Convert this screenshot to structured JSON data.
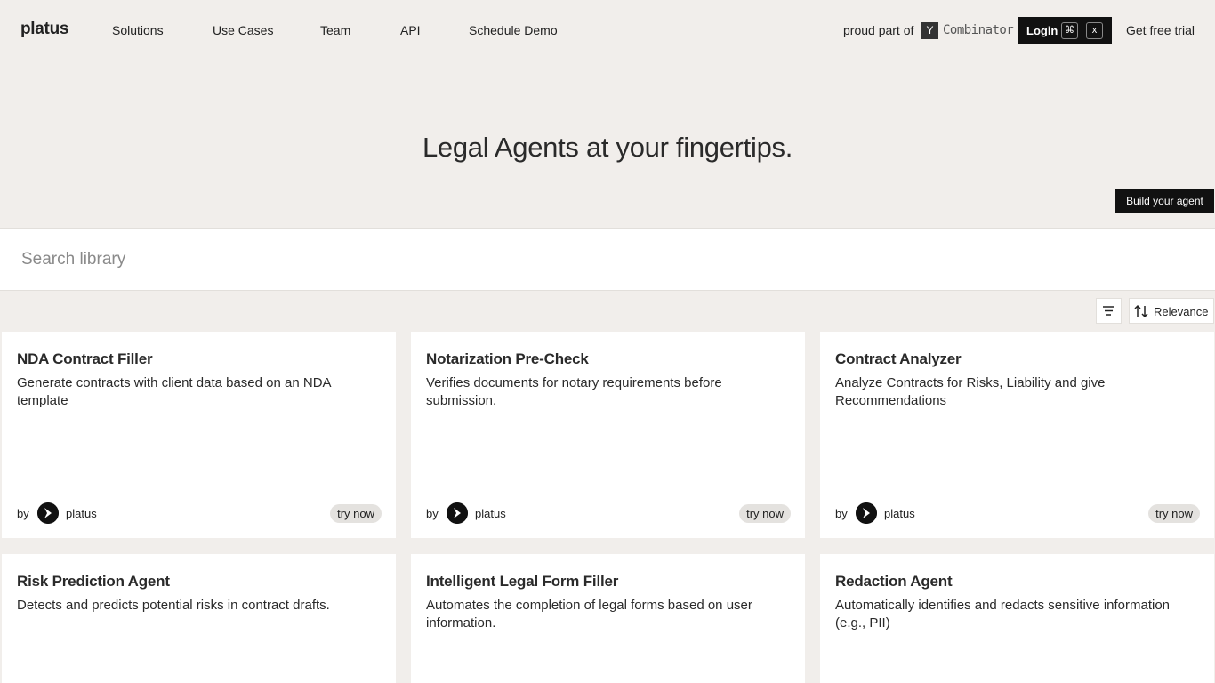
{
  "nav": {
    "logo": "platus",
    "links": [
      "Solutions",
      "Use Cases",
      "Team",
      "API",
      "Schedule Demo"
    ],
    "proud_text": "proud part of",
    "yc_letter": "Y",
    "yc_text": "Combinator",
    "login_label": "Login",
    "login_kbd_cmd": "⌘",
    "login_kbd_x": "x",
    "trial_label": "Get free trial"
  },
  "hero": {
    "title": "Legal Agents at your fingertips.",
    "build_label": "Build your agent"
  },
  "search": {
    "placeholder": "Search library"
  },
  "sort": {
    "label": "Relevance"
  },
  "cards": [
    {
      "title": "NDA Contract Filler",
      "desc": "Generate contracts with client data based on an NDA template",
      "by": "by",
      "author": "platus",
      "cta": "try now"
    },
    {
      "title": "Notarization Pre-Check",
      "desc": "Verifies documents for notary requirements before submission.",
      "by": "by",
      "author": "platus",
      "cta": "try now"
    },
    {
      "title": "Contract Analyzer",
      "desc": "Analyze Contracts for Risks, Liability and give Recommendations",
      "by": "by",
      "author": "platus",
      "cta": "try now"
    },
    {
      "title": "Risk Prediction Agent",
      "desc": "Detects and predicts potential risks in contract drafts."
    },
    {
      "title": "Intelligent Legal Form Filler",
      "desc": "Automates the completion of legal forms based on user information."
    },
    {
      "title": "Redaction Agent",
      "desc": "Automatically identifies and redacts sensitive information (e.g., PII)"
    }
  ],
  "colors": {
    "background": "#f1eeeb",
    "dark": "#111111",
    "pill": "#e4e2df"
  }
}
